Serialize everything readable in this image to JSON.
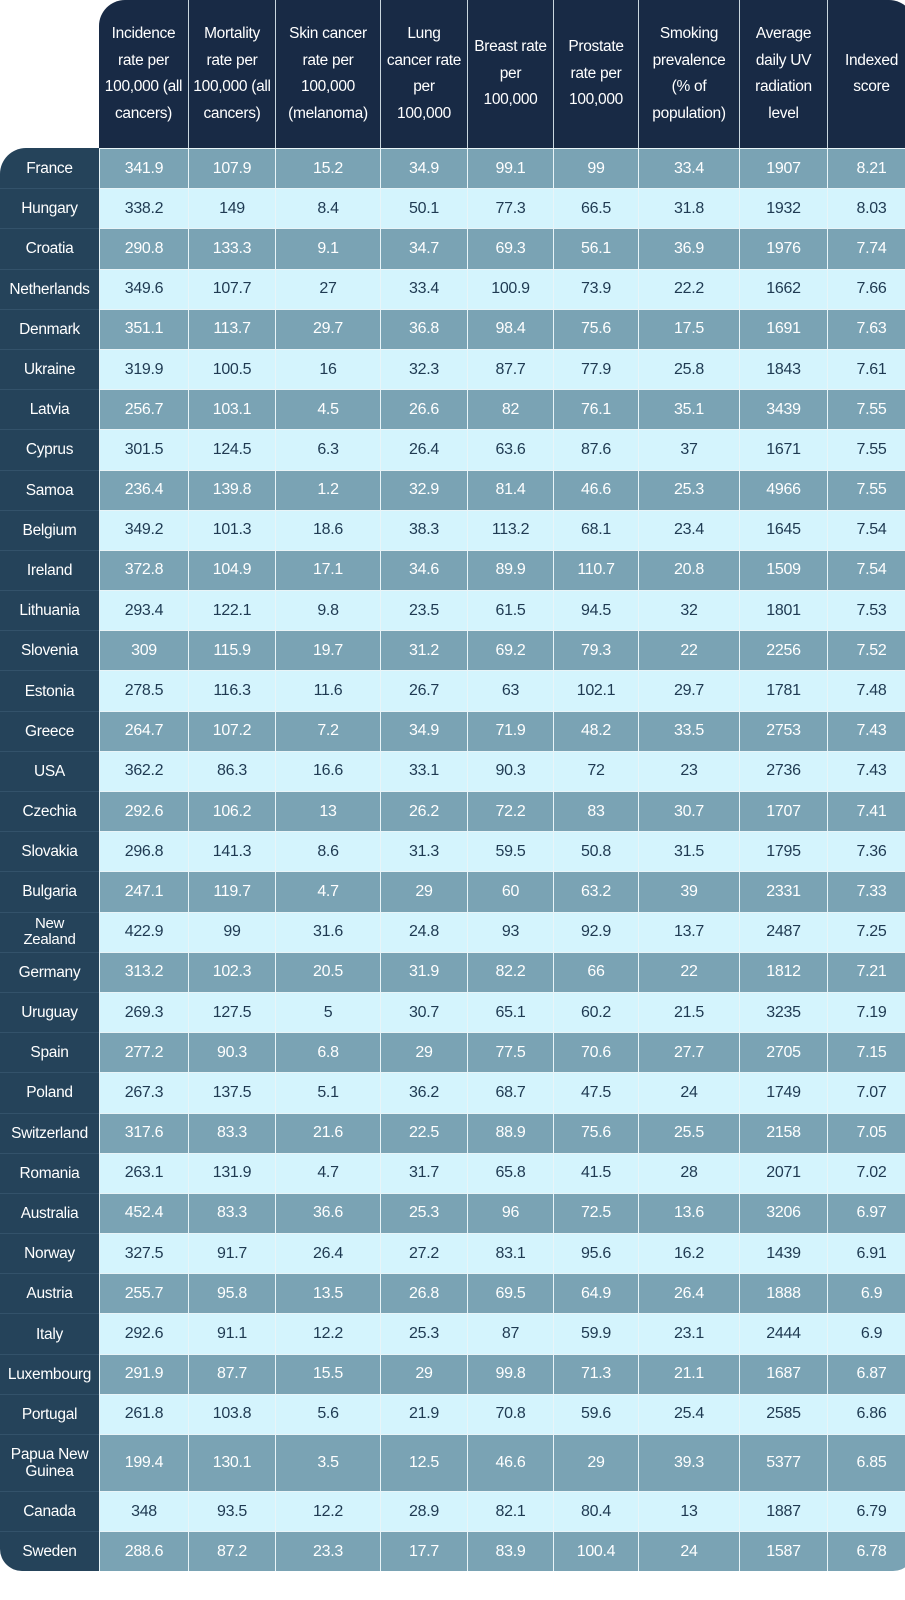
{
  "table": {
    "headers": [
      "",
      "Incidence rate per 100,000 (all cancers)",
      "Mortality rate per 100,000 (all cancers)",
      "Skin cancer rate per 100,000 (melanoma)",
      "Lung cancer rate per 100,000",
      "Breast rate per 100,000",
      "Prostate rate per 100,000",
      "Smoking prevalence (% of population)",
      "Average daily UV radiation level",
      "Indexed score"
    ],
    "rows": [
      [
        "France",
        "341.9",
        "107.9",
        "15.2",
        "34.9",
        "99.1",
        "99",
        "33.4",
        "1907",
        "8.21"
      ],
      [
        "Hungary",
        "338.2",
        "149",
        "8.4",
        "50.1",
        "77.3",
        "66.5",
        "31.8",
        "1932",
        "8.03"
      ],
      [
        "Croatia",
        "290.8",
        "133.3",
        "9.1",
        "34.7",
        "69.3",
        "56.1",
        "36.9",
        "1976",
        "7.74"
      ],
      [
        "Netherlands",
        "349.6",
        "107.7",
        "27",
        "33.4",
        "100.9",
        "73.9",
        "22.2",
        "1662",
        "7.66"
      ],
      [
        "Denmark",
        "351.1",
        "113.7",
        "29.7",
        "36.8",
        "98.4",
        "75.6",
        "17.5",
        "1691",
        "7.63"
      ],
      [
        "Ukraine",
        "319.9",
        "100.5",
        "16",
        "32.3",
        "87.7",
        "77.9",
        "25.8",
        "1843",
        "7.61"
      ],
      [
        "Latvia",
        "256.7",
        "103.1",
        "4.5",
        "26.6",
        "82",
        "76.1",
        "35.1",
        "3439",
        "7.55"
      ],
      [
        "Cyprus",
        "301.5",
        "124.5",
        "6.3",
        "26.4",
        "63.6",
        "87.6",
        "37",
        "1671",
        "7.55"
      ],
      [
        "Samoa",
        "236.4",
        "139.8",
        "1.2",
        "32.9",
        "81.4",
        "46.6",
        "25.3",
        "4966",
        "7.55"
      ],
      [
        "Belgium",
        "349.2",
        "101.3",
        "18.6",
        "38.3",
        "113.2",
        "68.1",
        "23.4",
        "1645",
        "7.54"
      ],
      [
        "Ireland",
        "372.8",
        "104.9",
        "17.1",
        "34.6",
        "89.9",
        "110.7",
        "20.8",
        "1509",
        "7.54"
      ],
      [
        "Lithuania",
        "293.4",
        "122.1",
        "9.8",
        "23.5",
        "61.5",
        "94.5",
        "32",
        "1801",
        "7.53"
      ],
      [
        "Slovenia",
        "309",
        "115.9",
        "19.7",
        "31.2",
        "69.2",
        "79.3",
        "22",
        "2256",
        "7.52"
      ],
      [
        "Estonia",
        "278.5",
        "116.3",
        "11.6",
        "26.7",
        "63",
        "102.1",
        "29.7",
        "1781",
        "7.48"
      ],
      [
        "Greece",
        "264.7",
        "107.2",
        "7.2",
        "34.9",
        "71.9",
        "48.2",
        "33.5",
        "2753",
        "7.43"
      ],
      [
        "USA",
        "362.2",
        "86.3",
        "16.6",
        "33.1",
        "90.3",
        "72",
        "23",
        "2736",
        "7.43"
      ],
      [
        "Czechia",
        "292.6",
        "106.2",
        "13",
        "26.2",
        "72.2",
        "83",
        "30.7",
        "1707",
        "7.41"
      ],
      [
        "Slovakia",
        "296.8",
        "141.3",
        "8.6",
        "31.3",
        "59.5",
        "50.8",
        "31.5",
        "1795",
        "7.36"
      ],
      [
        "Bulgaria",
        "247.1",
        "119.7",
        "4.7",
        "29",
        "60",
        "63.2",
        "39",
        "2331",
        "7.33"
      ],
      [
        "New Zealand",
        "422.9",
        "99",
        "31.6",
        "24.8",
        "93",
        "92.9",
        "13.7",
        "2487",
        "7.25"
      ],
      [
        "Germany",
        "313.2",
        "102.3",
        "20.5",
        "31.9",
        "82.2",
        "66",
        "22",
        "1812",
        "7.21"
      ],
      [
        "Uruguay",
        "269.3",
        "127.5",
        "5",
        "30.7",
        "65.1",
        "60.2",
        "21.5",
        "3235",
        "7.19"
      ],
      [
        "Spain",
        "277.2",
        "90.3",
        "6.8",
        "29",
        "77.5",
        "70.6",
        "27.7",
        "2705",
        "7.15"
      ],
      [
        "Poland",
        "267.3",
        "137.5",
        "5.1",
        "36.2",
        "68.7",
        "47.5",
        "24",
        "1749",
        "7.07"
      ],
      [
        "Switzerland",
        "317.6",
        "83.3",
        "21.6",
        "22.5",
        "88.9",
        "75.6",
        "25.5",
        "2158",
        "7.05"
      ],
      [
        "Romania",
        "263.1",
        "131.9",
        "4.7",
        "31.7",
        "65.8",
        "41.5",
        "28",
        "2071",
        "7.02"
      ],
      [
        "Australia",
        "452.4",
        "83.3",
        "36.6",
        "25.3",
        "96",
        "72.5",
        "13.6",
        "3206",
        "6.97"
      ],
      [
        "Norway",
        "327.5",
        "91.7",
        "26.4",
        "27.2",
        "83.1",
        "95.6",
        "16.2",
        "1439",
        "6.91"
      ],
      [
        "Austria",
        "255.7",
        "95.8",
        "13.5",
        "26.8",
        "69.5",
        "64.9",
        "26.4",
        "1888",
        "6.9"
      ],
      [
        "Italy",
        "292.6",
        "91.1",
        "12.2",
        "25.3",
        "87",
        "59.9",
        "23.1",
        "2444",
        "6.9"
      ],
      [
        "Luxembourg",
        "291.9",
        "87.7",
        "15.5",
        "29",
        "99.8",
        "71.3",
        "21.1",
        "1687",
        "6.87"
      ],
      [
        "Portugal",
        "261.8",
        "103.8",
        "5.6",
        "21.9",
        "70.8",
        "59.6",
        "25.4",
        "2585",
        "6.86"
      ],
      [
        "Papua New Guinea",
        "199.4",
        "130.1",
        "3.5",
        "12.5",
        "46.6",
        "29",
        "39.3",
        "5377",
        "6.85"
      ],
      [
        "Canada",
        "348",
        "93.5",
        "12.2",
        "28.9",
        "82.1",
        "80.4",
        "13",
        "1887",
        "6.79"
      ],
      [
        "Sweden",
        "288.6",
        "87.2",
        "23.3",
        "17.7",
        "83.9",
        "100.4",
        "24",
        "1587",
        "6.78"
      ]
    ]
  },
  "colors": {
    "header_bg": "#182a45",
    "country_bg": "#25435a",
    "row_dark": "#7aa3b4",
    "row_light": "#d4f4fd",
    "text_dark": "#1f3a52"
  }
}
